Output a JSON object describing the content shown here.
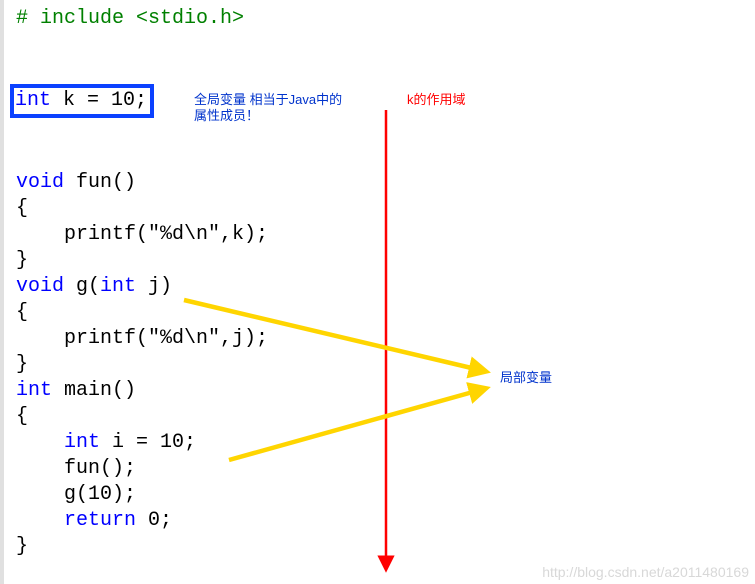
{
  "code": {
    "include_line": "# include <stdio.h>",
    "global_decl_kw": "int",
    "global_decl_rest": " k = 10;",
    "fun_void": "void",
    "fun_name": " fun()",
    "brace_open": "{",
    "printf_k": "    printf(\"%d\\n\",k);",
    "brace_close": "}",
    "g_void": "void",
    "g_name_1": " g(",
    "g_int": "int",
    "g_name_2": " j)",
    "printf_j": "    printf(\"%d\\n\",j);",
    "main_int": "int",
    "main_name": " main()",
    "int_i_kw": "    int",
    "int_i_rest": " i = 10;",
    "fun_call": "    fun();",
    "g_call": "    g(10);",
    "return_kw": "    return",
    "return_val": " 0;"
  },
  "annotations": {
    "global_note_l1": "全局变量 相当于Java中的",
    "global_note_l2": "属性成员！",
    "scope_note": "k的作用域",
    "local_note": "局部变量"
  },
  "watermark": "http://blog.csdn.net/a2011480169"
}
